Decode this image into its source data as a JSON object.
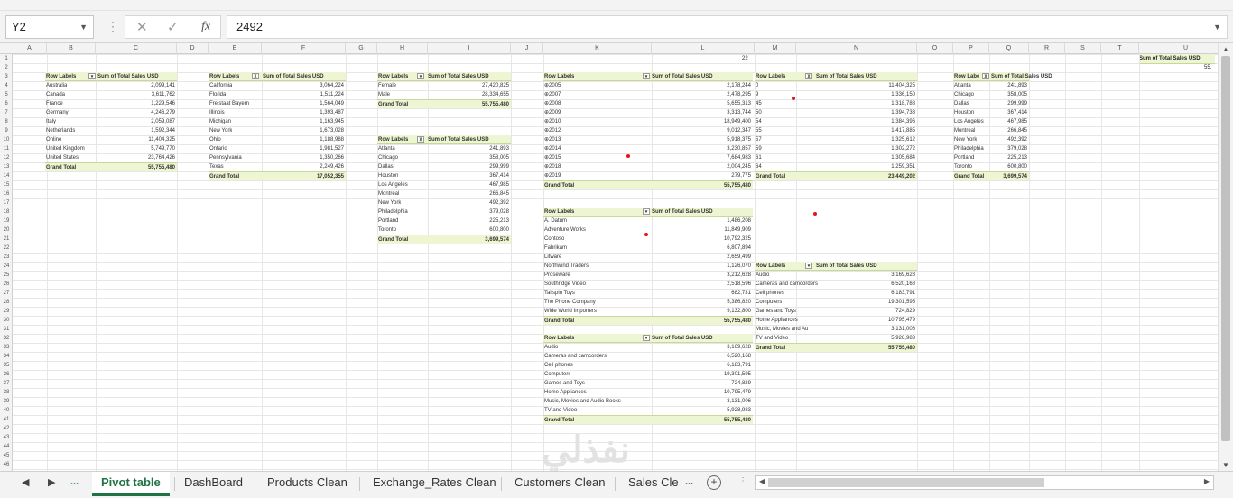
{
  "formula_bar": {
    "name_box": "Y2",
    "formula": "2492",
    "fx": "fx",
    "cancel_icon": "cancel-icon",
    "enter_icon": "enter-icon"
  },
  "columns": [
    "A",
    "B",
    "C",
    "D",
    "E",
    "F",
    "G",
    "H",
    "I",
    "J",
    "K",
    "L",
    "M",
    "N",
    "O",
    "P",
    "Q",
    "R",
    "S",
    "T",
    "U"
  ],
  "rows": [
    "1",
    "2",
    "3",
    "4",
    "5",
    "6",
    "7",
    "8",
    "9",
    "10",
    "11",
    "12",
    "13",
    "14",
    "15",
    "16",
    "17",
    "18",
    "19",
    "20",
    "21",
    "22",
    "23",
    "24",
    "25",
    "26",
    "27",
    "28",
    "29",
    "30",
    "31",
    "32",
    "33",
    "34",
    "35",
    "36",
    "37",
    "38",
    "39",
    "40",
    "41",
    "42",
    "43",
    "44",
    "45",
    "46"
  ],
  "pivot_country": {
    "h1": "Row Labels",
    "h2": "Sum of Total Sales USD",
    "rows": [
      [
        "Australia",
        "2,099,141"
      ],
      [
        "Canada",
        "3,611,762"
      ],
      [
        "France",
        "1,229,546"
      ],
      [
        "Germany",
        "4,246,279"
      ],
      [
        "Italy",
        "2,059,087"
      ],
      [
        "Netherlands",
        "1,592,344"
      ],
      [
        "Online",
        "11,404,325"
      ],
      [
        "United Kingdom",
        "5,749,770"
      ],
      [
        "United States",
        "23,764,426"
      ]
    ],
    "total": [
      "Grand Total",
      "55,755,480"
    ]
  },
  "pivot_state": {
    "h1": "Row Labels",
    "h2": "Sum of Total Sales USD",
    "rows": [
      [
        "California",
        "3,064,224"
      ],
      [
        "Florida",
        "1,511,224"
      ],
      [
        "Freistaat Bayern",
        "1,564,049"
      ],
      [
        "Illinois",
        "1,393,487"
      ],
      [
        "Michigan",
        "1,163,945"
      ],
      [
        "New York",
        "1,673,028"
      ],
      [
        "Ohio",
        "1,188,988"
      ],
      [
        "Ontario",
        "1,981,527"
      ],
      [
        "Pennsylvania",
        "1,350,266"
      ],
      [
        "Texas",
        "2,249,426"
      ]
    ],
    "total": [
      "Grand Total",
      "17,052,355"
    ]
  },
  "pivot_gender": {
    "h1": "Row Labels",
    "h2": "Sum of Total Sales USD",
    "rows": [
      [
        "Female",
        "27,420,825"
      ],
      [
        "Male",
        "28,334,655"
      ]
    ],
    "total": [
      "Grand Total",
      "55,755,480"
    ]
  },
  "pivot_city1": {
    "h1": "Row Labels",
    "h2": "Sum of Total Sales USD",
    "rows": [
      [
        "Atlanta",
        "241,893"
      ],
      [
        "Chicago",
        "358,005"
      ],
      [
        "Dallas",
        "299,999"
      ],
      [
        "Houston",
        "367,414"
      ],
      [
        "Los Angeles",
        "467,985"
      ],
      [
        "Montreal",
        "266,845"
      ],
      [
        "New York",
        "492,392"
      ],
      [
        "Philadelphia",
        "379,028"
      ],
      [
        "Portland",
        "225,213"
      ],
      [
        "Toronto",
        "600,800"
      ]
    ],
    "total": [
      "Grand Total",
      "3,699,574"
    ]
  },
  "pivot_year": {
    "h1": "Row Labels",
    "h2": "Sum of Total Sales USD",
    "rows": [
      [
        "⊕2005",
        "2,178,244"
      ],
      [
        "⊕2007",
        "2,478,295"
      ],
      [
        "⊕2008",
        "5,655,313"
      ],
      [
        "⊕2009",
        "3,313,744"
      ],
      [
        "⊕2010",
        "18,949,400"
      ],
      [
        "⊕2012",
        "9,012,347"
      ],
      [
        "⊕2013",
        "5,918,375"
      ],
      [
        "⊕2014",
        "3,230,857"
      ],
      [
        "⊕2015",
        "7,684,983"
      ],
      [
        "⊕2018",
        "2,004,245"
      ],
      [
        "⊕2019",
        "279,775"
      ]
    ],
    "total": [
      "Grand Total",
      "55,755,480"
    ]
  },
  "pivot_brand": {
    "h1": "Row Labels",
    "h2": "Sum of Total Sales USD",
    "rows": [
      [
        "A. Datum",
        "1,486,208"
      ],
      [
        "Adventure Works",
        "11,849,909"
      ],
      [
        "Contoso",
        "10,792,325"
      ],
      [
        "Fabrikam",
        "6,807,894"
      ],
      [
        "Litware",
        "2,659,499"
      ],
      [
        "Northwind Traders",
        "1,126,070"
      ],
      [
        "Proseware",
        "3,212,628"
      ],
      [
        "Southridge Video",
        "2,518,596"
      ],
      [
        "Tailspin Toys",
        "682,731"
      ],
      [
        "The Phone Company",
        "5,386,820"
      ],
      [
        "Wide World Importers",
        "9,132,800"
      ]
    ],
    "total": [
      "Grand Total",
      "55,755,480"
    ]
  },
  "pivot_category1": {
    "h1": "Row Labels",
    "h2": "Sum of Total Sales USD",
    "rows": [
      [
        "Audio",
        "3,169,628"
      ],
      [
        "Cameras and camcorders",
        "6,520,168"
      ],
      [
        "Cell phones",
        "6,183,791"
      ],
      [
        "Computers",
        "19,301,595"
      ],
      [
        "Games and Toys",
        "724,829"
      ],
      [
        "Home Appliances",
        "10,795,479"
      ],
      [
        "Music, Movies and Audio Books",
        "3,131,006"
      ],
      [
        "TV and Video",
        "5,928,983"
      ]
    ],
    "total": [
      "Grand Total",
      "55,755,480"
    ]
  },
  "pivot_age": {
    "h1": "Row Labels",
    "h2": "Sum of Total Sales USD",
    "rows": [
      [
        "0",
        "11,404,325"
      ],
      [
        "9",
        "1,336,150"
      ],
      [
        "45",
        "1,318,788"
      ],
      [
        "50",
        "1,394,738"
      ],
      [
        "54",
        "1,384,396"
      ],
      [
        "55",
        "1,417,885"
      ],
      [
        "57",
        "1,325,612"
      ],
      [
        "59",
        "1,302,272"
      ],
      [
        "61",
        "1,305,684"
      ],
      [
        "64",
        "1,259,351"
      ]
    ],
    "total": [
      "Grand Total",
      "23,449,202"
    ]
  },
  "pivot_category2": {
    "h1": "Row Labels",
    "h2": "Sum of Total Sales USD",
    "rows": [
      [
        "Audio",
        "3,169,628"
      ],
      [
        "Cameras and camcorders",
        "6,520,168"
      ],
      [
        "Cell phones",
        "6,183,791"
      ],
      [
        "Computers",
        "19,301,595"
      ],
      [
        "Games and Toys",
        "724,829"
      ],
      [
        "Home Appliances",
        "10,795,479"
      ],
      [
        "Music, Movies and Au",
        "3,131,006"
      ],
      [
        "TV and Video",
        "5,928,983"
      ]
    ],
    "total": [
      "Grand Total",
      "55,755,480"
    ]
  },
  "pivot_city2": {
    "h1": "Row Labe",
    "h2": "Sum of Total Sales USD",
    "rows": [
      [
        "Atlanta",
        "241,893"
      ],
      [
        "Chicago",
        "358,005"
      ],
      [
        "Dallas",
        "299,999"
      ],
      [
        "Houston",
        "367,414"
      ],
      [
        "Los Angeles",
        "467,985"
      ],
      [
        "Montreal",
        "266,845"
      ],
      [
        "New York",
        "492,392"
      ],
      [
        "Philadelphia",
        "379,028"
      ],
      [
        "Portland",
        "225,213"
      ],
      [
        "Toronto",
        "600,800"
      ]
    ],
    "total": [
      "Grand Total",
      "3,699,574"
    ]
  },
  "stray_cells": {
    "l1": "22",
    "u1": "Sum of Total Sales USD",
    "u2": "55,"
  },
  "watermark": "نفذلي",
  "sheet_tabs": {
    "nav_prev": "◀",
    "nav_next": "▶",
    "more": "...",
    "tabs": [
      "Pivot table",
      "DashBoard",
      "Products Clean",
      "Exchange_Rates Clean",
      "Customers Clean",
      "Sales Cle"
    ],
    "more_right": "...",
    "add": "+",
    "active": "Pivot table"
  }
}
